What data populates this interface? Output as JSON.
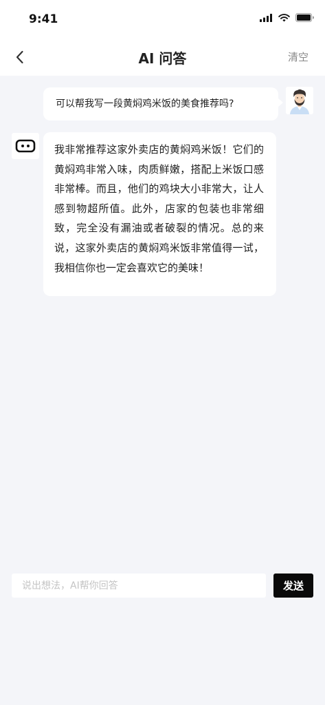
{
  "status_bar": {
    "time": "9:41",
    "icons": [
      "signal-icon",
      "wifi-icon",
      "battery-icon"
    ]
  },
  "header": {
    "title": "AI 问答",
    "clear_label": "清空",
    "back_icon": "chevron-left-icon"
  },
  "messages": [
    {
      "role": "user",
      "avatar": "user-avatar",
      "text": "可以帮我写一段黄焖鸡米饭的美食推荐吗?"
    },
    {
      "role": "bot",
      "avatar": "robot-icon",
      "text": "我非常推荐这家外卖店的黄焖鸡米饭！它们的黄焖鸡非常入味，肉质鲜嫩，搭配上米饭口感非常棒。而且，他们的鸡块大小非常大，让人感到物超所值。此外，店家的包装也非常细致，完全没有漏油或者破裂的情况。总的来说，这家外卖店的黄焖鸡米饭非常值得一试，我相信你也一定会喜欢它的美味！"
    }
  ],
  "composer": {
    "placeholder": "说出想法，AI帮你回答",
    "value": "",
    "send_label": "发送"
  },
  "colors": {
    "background": "#f4f5f9",
    "bubble": "#ffffff",
    "send_button": "#0a0a0a",
    "placeholder": "#c4c4c4"
  }
}
